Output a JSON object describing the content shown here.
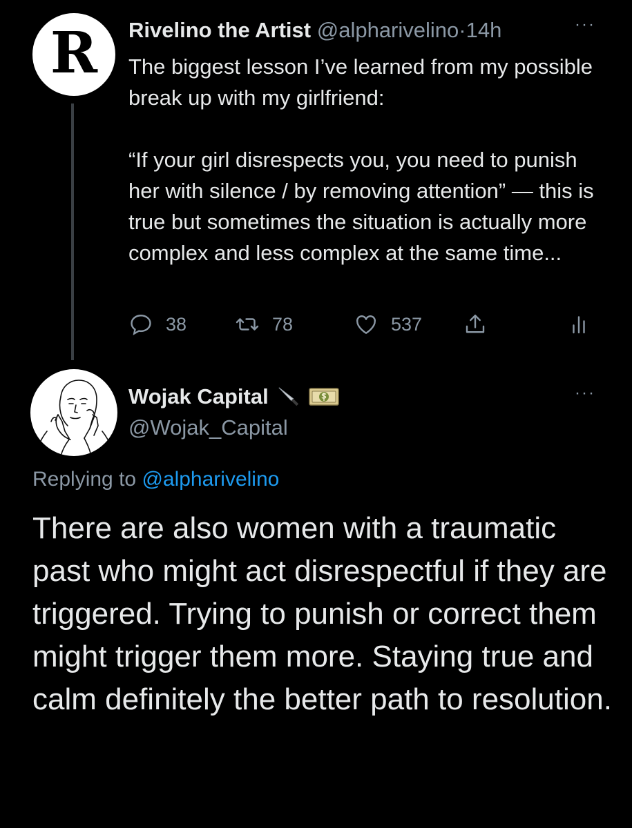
{
  "tweet1": {
    "avatar_letter": "R",
    "name": "Rivelino the Artist",
    "handle": "@alpharivelino",
    "dot": "·",
    "time": "14h",
    "more": "···",
    "paragraph1": "The biggest lesson I’ve learned from my possible break up with my girlfriend:",
    "paragraph2": "“If your girl disrespects you, you need to punish her with silence / by removing attention” — this is true but sometimes the situation is actually more complex and less complex at the same time...",
    "replies": "38",
    "retweets": "78",
    "likes": "537",
    "icons": {
      "reply": "reply-icon",
      "retweet": "retweet-icon",
      "like": "heart-icon",
      "share": "share-icon",
      "analytics": "analytics-icon"
    }
  },
  "tweet2": {
    "name": "Wojak Capital",
    "emoji_icons": [
      "knife-icon",
      "money-icon"
    ],
    "handle": "@Wojak_Capital",
    "more": "···",
    "replying_prefix": "Replying to",
    "replying_handle": "@alpharivelino",
    "body": "There are also women with a traumatic past who might act disrespectful if they are triggered. Trying to punish or correct them might trigger them more. Staying true and calm definitely the better path to resolution."
  },
  "colors": {
    "background": "#000000",
    "text": "#e7e9ea",
    "secondary": "#8b98a5",
    "link": "#1d9bf0",
    "thread_line": "#3a3f44"
  }
}
